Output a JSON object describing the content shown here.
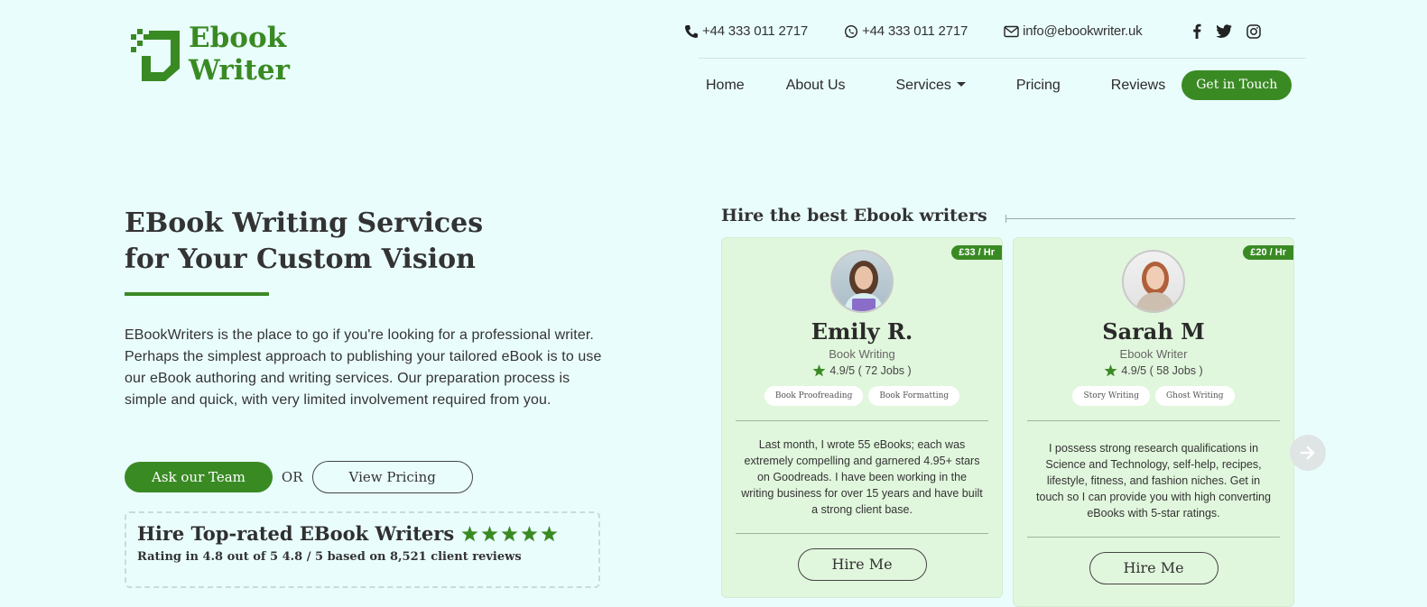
{
  "brand": {
    "line1": "Ebook",
    "line2": "Writer",
    "color": "#3a8a24"
  },
  "contact": {
    "phone": "+44 333 011 2717",
    "whatsapp": "+44 333 011 2717",
    "email": "info@ebookwriter.uk",
    "socials": [
      "facebook-icon",
      "twitter-icon",
      "instagram-icon"
    ]
  },
  "nav": {
    "items": [
      "Home",
      "About Us",
      "Services",
      "Pricing",
      "Reviews"
    ],
    "cta": "Get in Touch"
  },
  "hero": {
    "title_line1": "EBook Writing Services",
    "title_line2": "for Your Custom Vision",
    "description": "EBookWriters is the place to go if you're looking for a professional writer. Perhaps the simplest approach to publishing your tailored eBook is to use our eBook authoring and writing services. Our preparation process is simple and quick, with very limited involvement required from you.",
    "ask_button": "Ask our Team",
    "or_text": "OR",
    "pricing_button": "View Pricing"
  },
  "rating_box": {
    "title": "Hire Top-rated EBook Writers",
    "stars": 5,
    "subtitle": "Rating in 4.8 out of 5 4.8 / 5 based on 8,521 client reviews"
  },
  "writers": {
    "heading": "Hire the best Ebook writers",
    "cards": [
      {
        "price": "£33 / Hr",
        "name": "Emily R.",
        "role": "Book Writing",
        "rating": "4.9/5 ( 72 Jobs )",
        "tags": [
          "Book Proofreading",
          "Book Formatting"
        ],
        "bio": "Last month, I wrote 55 eBooks; each was extremely compelling and garnered 4.95+ stars on Goodreads. I have been working in the writing business for over 15 years and have built a strong client base.",
        "button": "Hire Me"
      },
      {
        "price": "£20 / Hr",
        "name": "Sarah M",
        "role": "Ebook Writer",
        "rating": "4.9/5 ( 58 Jobs )",
        "tags": [
          "Story Writing",
          "Ghost Writing"
        ],
        "bio": "I possess strong research qualifications in Science and Technology, self-help, recipes, lifestyle, fitness, and fashion niches. Get in touch so I can provide you with high converting eBooks with 5-star ratings.",
        "button": "Hire Me"
      }
    ]
  },
  "colors": {
    "accent": "#3a8a24",
    "background": "#eafdfd",
    "card": "#e1f7dd"
  }
}
